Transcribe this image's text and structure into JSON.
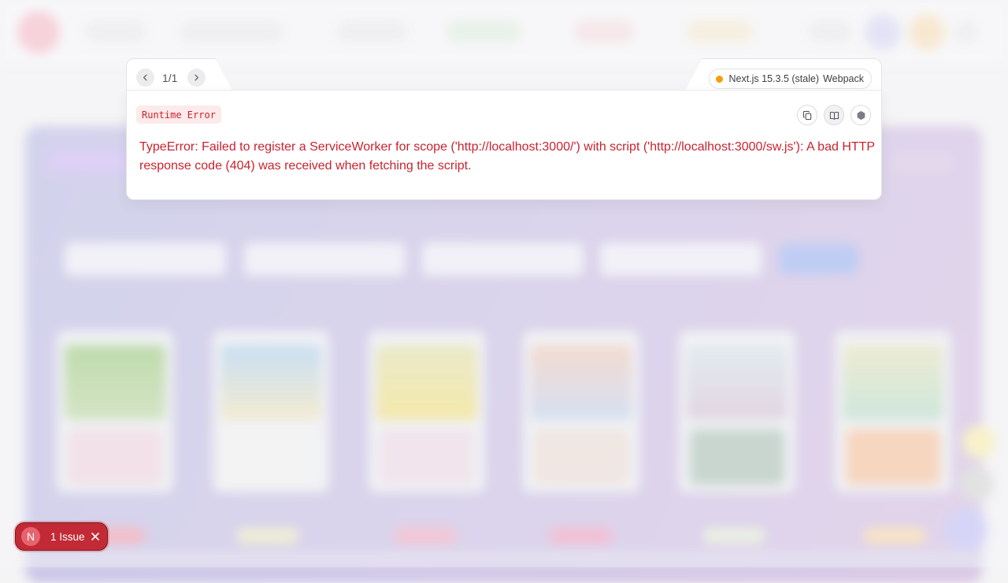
{
  "pager": {
    "counter": "1/1"
  },
  "build": {
    "framework_version": "Next.js 15.3.5 (stale)",
    "bundler": "Webpack",
    "status_color": "#f59e0b"
  },
  "error": {
    "type_label": "Runtime Error",
    "message": "TypeError: Failed to register a ServiceWorker for scope ('http://localhost:3000/') with script ('http://localhost:3000/sw.js'): A bad HTTP response code (404) was received when fetching the script.",
    "accent_color": "#c9232f"
  },
  "toolbar": {
    "icons": [
      "copy-icon",
      "docs-book-icon",
      "nodejs-hexagon-icon"
    ]
  },
  "issue_badge": {
    "logo_letter": "N",
    "label": "1 Issue",
    "color": "#c22a35"
  }
}
